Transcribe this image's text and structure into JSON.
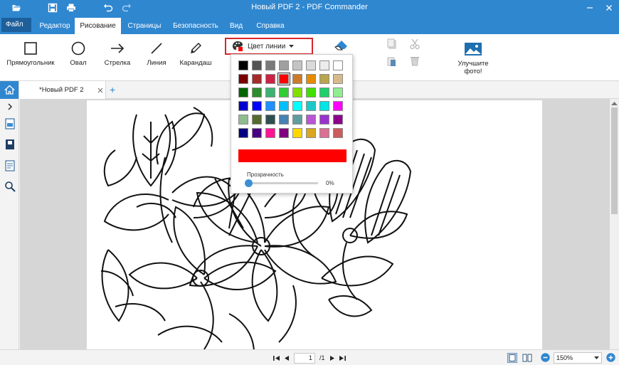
{
  "window": {
    "title": "Новый PDF 2 - PDF Commander"
  },
  "menu": {
    "file": "Файл",
    "tabs": [
      "Редактор",
      "Рисование",
      "Страницы",
      "Безопасность",
      "Вид",
      "Справка"
    ],
    "active": "Рисование"
  },
  "ribbon": {
    "rectangle": "Прямоугольник",
    "oval": "Овал",
    "arrow": "Стрелка",
    "line": "Линия",
    "pencil": "Карандаш",
    "line_color": "Цвет линии",
    "enhance_photo": "Улучшите фото!"
  },
  "doc": {
    "tab_label": "*Новый PDF 2",
    "add_tab": "+"
  },
  "color_popup": {
    "swatches": [
      [
        "#000000",
        "#545454",
        "#7a7a7a",
        "#a0a0a0",
        "#c4c4c4",
        "#dadada",
        "#ececec",
        "#ffffff"
      ],
      [
        "#7b0000",
        "#a52a2a",
        "#cc2244",
        "#ff0000",
        "#cc7a2a",
        "#e58b00",
        "#b8a54e",
        "#d8b98a"
      ],
      [
        "#006400",
        "#2e8b2e",
        "#3cb371",
        "#32cd32",
        "#7fe000",
        "#40e000",
        "#1fcf6a",
        "#90ee90"
      ],
      [
        "#0000cd",
        "#0000ff",
        "#1e90ff",
        "#00bfff",
        "#00ffff",
        "#1ec8c8",
        "#00e5e5",
        "#ff00ff"
      ],
      [
        "#8fbc8f",
        "#556b2f",
        "#2f4f4f",
        "#4682b4",
        "#5f9ea0",
        "#ba55d3",
        "#9932cc",
        "#8b008b"
      ],
      [
        "#000080",
        "#4b0082",
        "#ff1493",
        "#800080",
        "#ffd700",
        "#daa520",
        "#db7093",
        "#cd5c5c"
      ]
    ],
    "selected": "#ff0000",
    "current_color": "#ff0000",
    "opacity_label": "Прозрачность",
    "opacity_value": "0%"
  },
  "status": {
    "page_current": "1",
    "page_total": "/1",
    "zoom": "150%"
  },
  "colors": {
    "accent": "#2f87d0",
    "highlight": "#d9262b"
  }
}
